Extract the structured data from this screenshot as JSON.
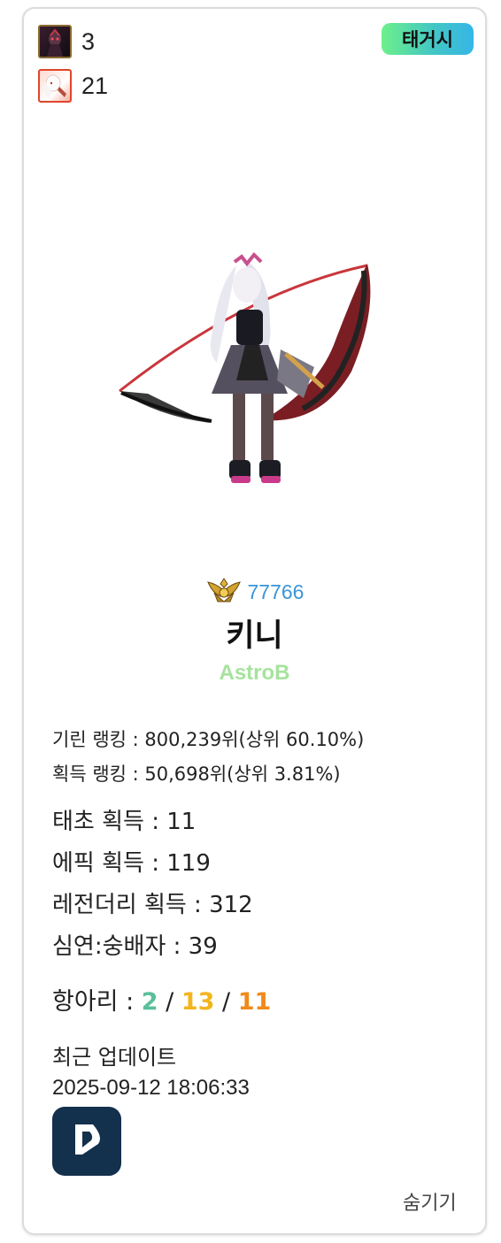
{
  "badges": [
    {
      "icon": "dark-knight-portrait-icon",
      "count": "3"
    },
    {
      "icon": "white-haired-character-portrait-icon",
      "count": "21"
    }
  ],
  "tag": "태거시",
  "character": {
    "art": "scythe-wielder-character-art",
    "rank_icon": "gold-wing-rank-icon",
    "rank_number": "77766",
    "name": "키니",
    "guild": "AstroB"
  },
  "rankings": {
    "kirin": "기린 랭킹 : 800,239위(상위 60.10%)",
    "acquire": "획득 랭킹 : 50,698위(상위 3.81%)"
  },
  "stats": {
    "primeval": "태초 획득 : 11",
    "epic": "에픽 획득 : 119",
    "legendary": "레전더리 획득 : 312",
    "abyss": "심연:숭배자 : 39"
  },
  "hangari": {
    "label": "항아리 : ",
    "a": "2",
    "sep1": " / ",
    "b": "13",
    "sep2": " / ",
    "c": "11"
  },
  "update": {
    "label": "최근 업데이트",
    "time": "2025-09-12 18:06:33"
  },
  "app_button_icon": "dnf-app-logo-icon",
  "hide_label": "숨기기",
  "colors": {
    "rank_number": "#3b95d8",
    "guild": "#a6e39d",
    "hangari_a": "#5bbf9b",
    "hangari_b": "#f3b51d",
    "hangari_c": "#f08a1a",
    "app_button_bg": "#13304d"
  }
}
